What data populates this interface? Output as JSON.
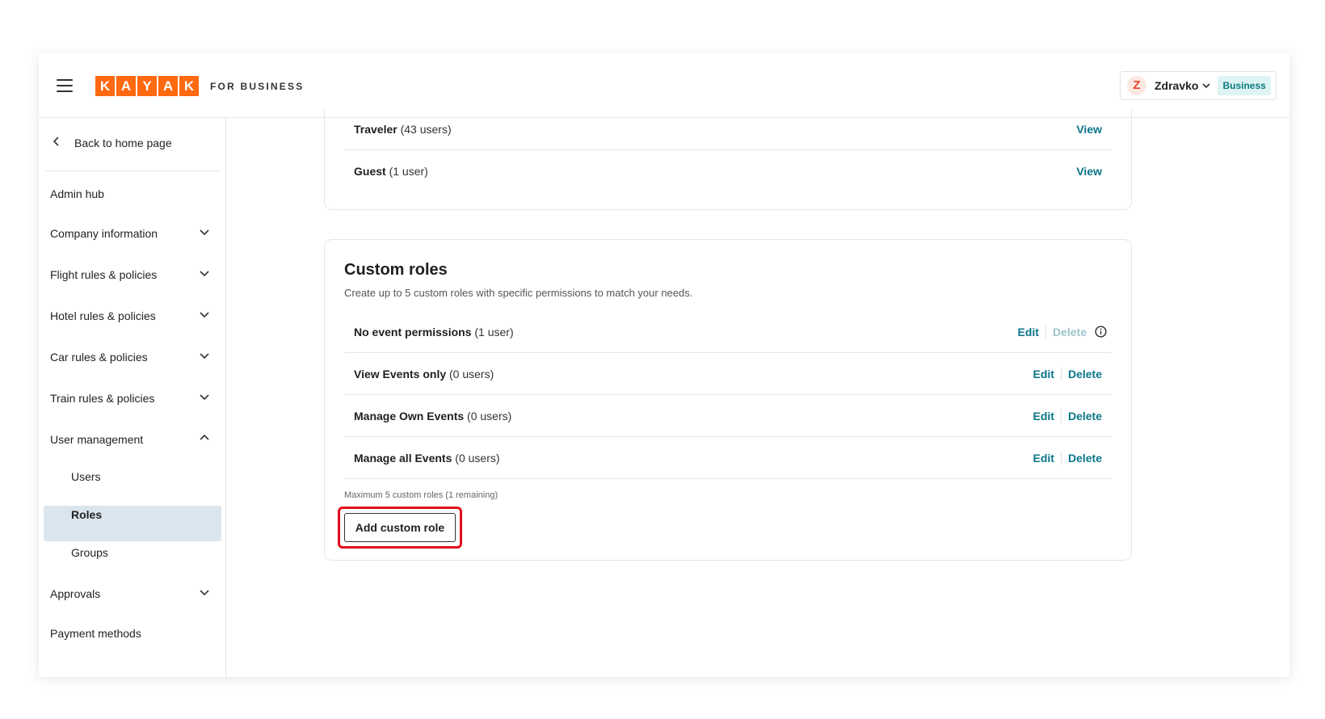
{
  "brand": {
    "logo_letters": [
      "K",
      "A",
      "Y",
      "A",
      "K"
    ],
    "suffix": "FOR BUSINESS",
    "accent": "#ff690f"
  },
  "header": {
    "menu_icon": "hamburger-icon",
    "account": {
      "initial": "Z",
      "name": "Zdravko",
      "badge": "Business"
    }
  },
  "sidebar": {
    "back_label": "Back to home page",
    "items": [
      {
        "label": "Admin hub"
      },
      {
        "label": "Company information"
      },
      {
        "label": "Flight rules & policies"
      },
      {
        "label": "Hotel rules & policies"
      },
      {
        "label": "Car rules & policies"
      },
      {
        "label": "Train rules & policies"
      },
      {
        "label": "User management"
      },
      {
        "label": "Approvals"
      },
      {
        "label": "Payment methods"
      }
    ],
    "user_management_children": [
      {
        "label": "Users"
      },
      {
        "label": "Roles",
        "active": true
      },
      {
        "label": "Groups"
      }
    ]
  },
  "default_roles": [
    {
      "name": "Traveler",
      "count": "(43 users)",
      "action": "View"
    },
    {
      "name": "Guest",
      "count": "(1 user)",
      "action": "View"
    }
  ],
  "custom_roles": {
    "title": "Custom roles",
    "description": "Create up to 5 custom roles with specific permissions to match your needs.",
    "edit_label": "Edit",
    "delete_label": "Delete",
    "rows": [
      {
        "name": "No event permissions",
        "count": "(1 user)"
      },
      {
        "name": "View Events only",
        "count": "(0 users)"
      },
      {
        "name": "Manage Own Events",
        "count": "(0 users)"
      },
      {
        "name": "Manage all Events",
        "count": "(0 users)"
      }
    ],
    "limit_note": "Maximum 5 custom roles (1 remaining)",
    "add_button": "Add custom role"
  },
  "colors": {
    "link": "#0a7689",
    "link_disabled": "#9cc5cc",
    "highlight": "#e0101a",
    "active_nav_bg": "#dbe5ee"
  }
}
